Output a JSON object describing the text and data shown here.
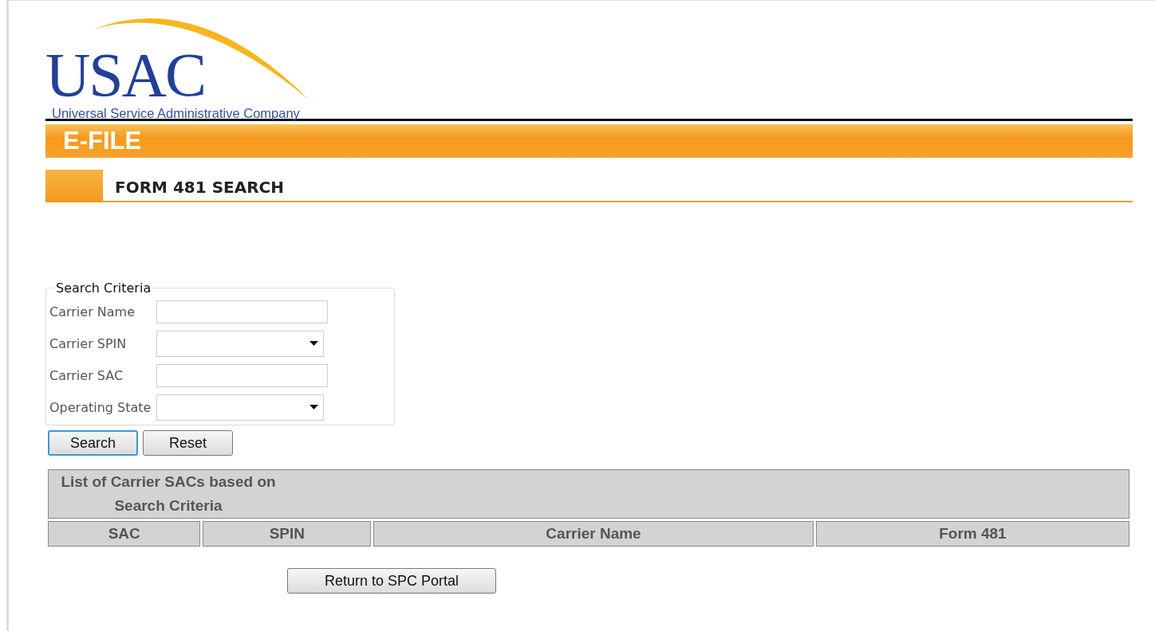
{
  "logo": {
    "wordmark": "USAC",
    "tagline": "Universal Service Administrative Company"
  },
  "banner": {
    "title": "E-FILE"
  },
  "page_heading": "FORM 481 SEARCH",
  "search_criteria": {
    "legend": "Search Criteria",
    "fields": [
      {
        "label": "Carrier Name",
        "kind": "text"
      },
      {
        "label": "Carrier SPIN",
        "kind": "select"
      },
      {
        "label": "Carrier SAC",
        "kind": "text"
      },
      {
        "label": "Operating State",
        "kind": "select"
      }
    ],
    "buttons": [
      {
        "label": "Search",
        "focused": true
      },
      {
        "label": "Reset",
        "focused": false
      }
    ]
  },
  "table": {
    "caption": "List of Carrier SACs based on Search Criteria",
    "columns": [
      "SAC",
      "SPIN",
      "Carrier Name",
      "Form 481"
    ]
  },
  "footer_button": "Return to SPC Portal"
}
